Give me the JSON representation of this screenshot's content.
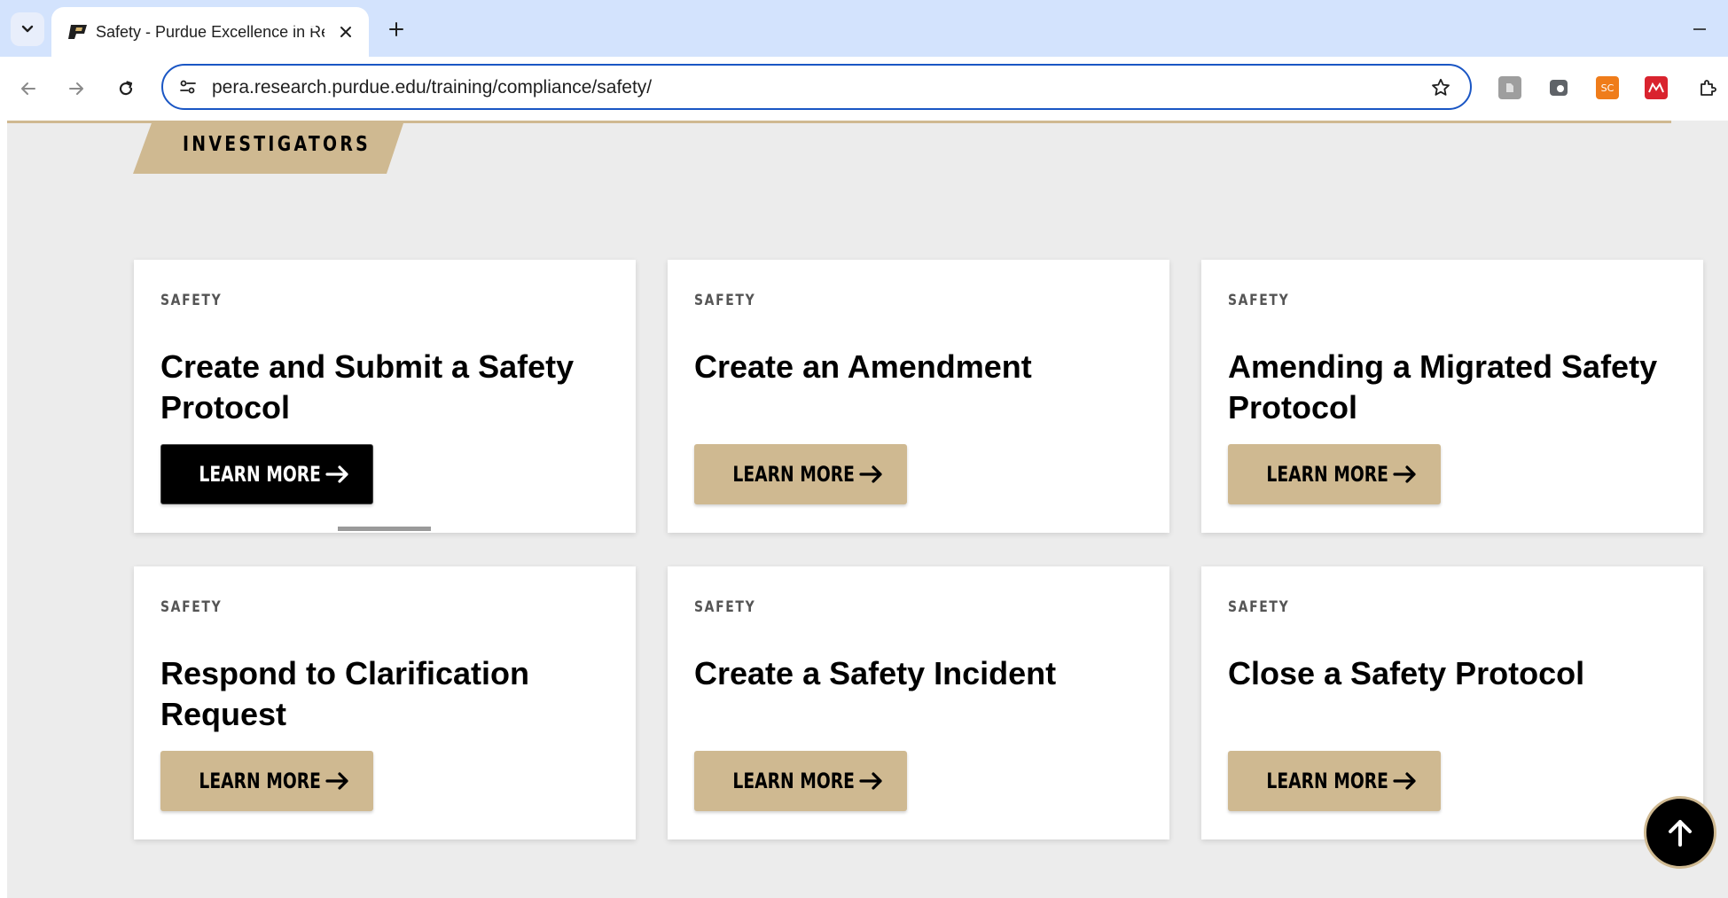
{
  "browser": {
    "tab": {
      "title": "Safety - Purdue Excellence in Research Administration",
      "favicon": "purdue-p-logo"
    },
    "url": "pera.research.purdue.edu/training/compliance/safety/",
    "extensions": [
      {
        "name": "grey-extension",
        "color": "#9e9e9e",
        "label": ""
      },
      {
        "name": "dark-extension",
        "color": "#5f6368",
        "label": ""
      },
      {
        "name": "sc-extension",
        "color": "#ef7c1a",
        "label": "SC"
      },
      {
        "name": "red-extension",
        "color": "#d9232e",
        "label": ""
      }
    ]
  },
  "page": {
    "section_label": "INVESTIGATORS",
    "accent_color": "#cfb991",
    "cards": [
      {
        "eyebrow": "SAFETY",
        "title": "Create and Submit a Safety Protocol",
        "button": "LEARN MORE",
        "focused": true
      },
      {
        "eyebrow": "SAFETY",
        "title": "Create an Amendment",
        "button": "LEARN MORE",
        "focused": false
      },
      {
        "eyebrow": "SAFETY",
        "title": "Amending a Migrated Safety Protocol",
        "button": "LEARN MORE",
        "focused": false
      },
      {
        "eyebrow": "SAFETY",
        "title": "Respond to Clarification Request",
        "button": "LEARN MORE",
        "focused": false
      },
      {
        "eyebrow": "SAFETY",
        "title": "Create a Safety Incident",
        "button": "LEARN MORE",
        "focused": false
      },
      {
        "eyebrow": "SAFETY",
        "title": "Close a Safety Protocol",
        "button": "LEARN MORE",
        "focused": false
      }
    ]
  }
}
